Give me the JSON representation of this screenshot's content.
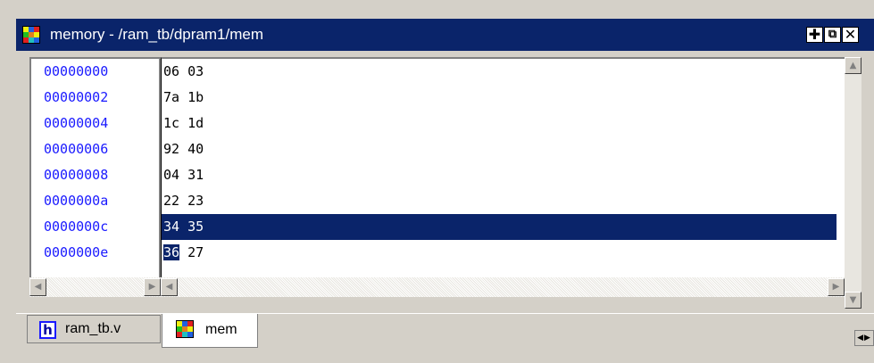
{
  "window": {
    "title": "memory - /ram_tb/dpram1/mem",
    "controls": [
      {
        "name": "dock-icon",
        "glyph": "✚"
      },
      {
        "name": "undock-icon",
        "glyph": "⧉"
      },
      {
        "name": "close-icon",
        "glyph": "✕"
      }
    ]
  },
  "memory": {
    "rows": [
      {
        "address": "00000000",
        "data": "06 03",
        "selected": false
      },
      {
        "address": "00000002",
        "data": "7a 1b",
        "selected": false
      },
      {
        "address": "00000004",
        "data": "1c 1d",
        "selected": false
      },
      {
        "address": "00000006",
        "data": "92 40",
        "selected": false
      },
      {
        "address": "00000008",
        "data": "04 31",
        "selected": false
      },
      {
        "address": "0000000a",
        "data": "22 23",
        "selected": false
      },
      {
        "address": "0000000c",
        "data": "34 35",
        "selected": true
      },
      {
        "address": "0000000e",
        "data": "36 27",
        "selected": false,
        "selected_cell": "36",
        "rest": " 27"
      }
    ]
  },
  "tabs": [
    {
      "label": "ram_tb.v",
      "icon": "verilog-file-icon",
      "icon_glyph": "h",
      "active": false
    },
    {
      "label": "mem",
      "icon": "memory-grid-icon",
      "active": true
    }
  ],
  "colors": {
    "titlebar": "#0a246a",
    "address_text": "#1a1aff",
    "selection": "#0a246a",
    "chrome": "#d4d0c8"
  }
}
